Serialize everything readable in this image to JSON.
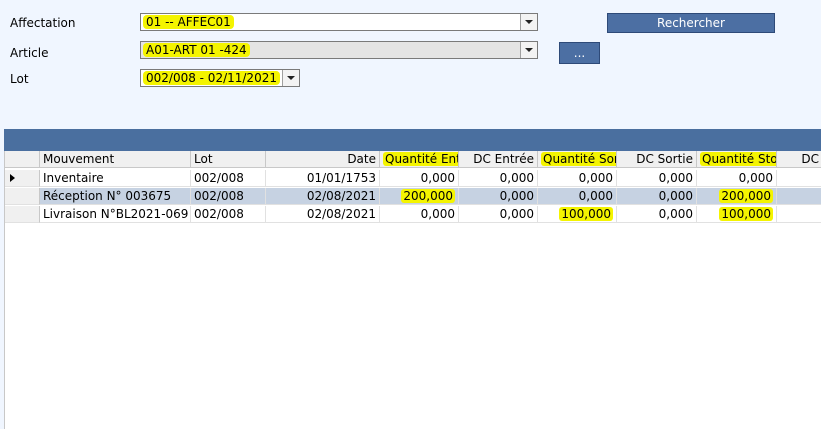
{
  "filters": {
    "affectation_label": "Affectation",
    "affectation_value": "01 -- AFFEC01",
    "article_label": "Article",
    "article_value": "A01-ART 01 -424",
    "lot_label": "Lot",
    "lot_value": "002/008 - 02/11/2021",
    "search_button": "Rechercher",
    "ellipsis_button": "..."
  },
  "table": {
    "headers": [
      "Mouvement",
      "Lot",
      "Date",
      "Quantité Ent",
      "DC Entrée",
      "Quantité Sor",
      "DC Sortie",
      "Quantité Sto",
      "DC"
    ],
    "rows": [
      [
        "Inventaire",
        "002/008",
        "01/01/1753",
        "0,000",
        "0,000",
        "0,000",
        "0,000",
        "0,000",
        ""
      ],
      [
        "Réception N° 003675",
        "002/008",
        "02/08/2021",
        "200,000",
        "0,000",
        "0,000",
        "0,000",
        "200,000",
        ""
      ],
      [
        "Livraison N°BL2021-069",
        "002/008",
        "02/08/2021",
        "0,000",
        "0,000",
        "100,000",
        "0,000",
        "100,000",
        ""
      ]
    ]
  },
  "colors": {
    "highlight": "#f4f400",
    "band": "#4a6f9f",
    "button": "#4c6fa3",
    "selected_row": "#c6d2e2"
  }
}
